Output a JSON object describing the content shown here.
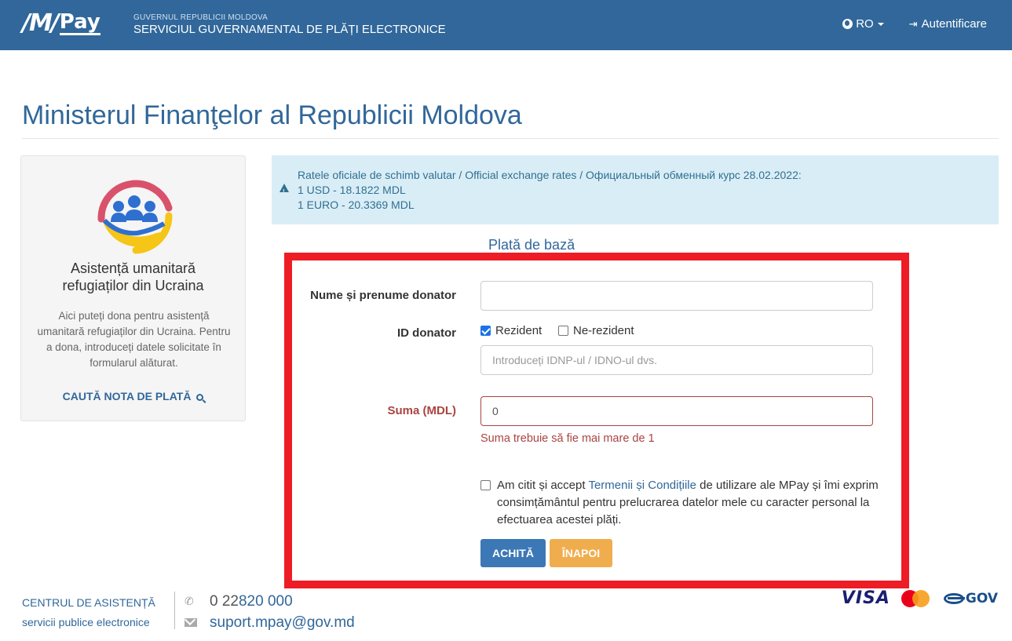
{
  "header": {
    "logo_mark": "/M/",
    "logo_pay": "Pay",
    "gov_subtitle": "GUVERNUL REPUBLICII MOLDOVA",
    "gov_title": "SERVICIUL GUVERNAMENTAL DE PLĂȚI ELECTRONICE",
    "language": "RO",
    "login": "Autentificare",
    "icons": {
      "language": "globe-icon",
      "login": "sign-in-icon"
    }
  },
  "page_title": "Ministerul Finanţelor al Republicii Moldova",
  "sidebar": {
    "title_line1": "Asistență umanitară",
    "title_line2": "refugiaților din Ucraina",
    "text": "Aici puteți dona pentru asistență umanitară refugiaților din Ucraina. Pentru a dona, introduceți datele solicitate în formularul alăturat.",
    "link": "CAUTĂ NOTA DE PLATĂ",
    "link_icon": "search-icon"
  },
  "alert": {
    "icon": "warning-icon",
    "line1": "Ratele oficiale de schimb valutar / Official exchange rates / Официальный обменный курс 28.02.2022:",
    "line2": "1 USD - 18.1822 MDL",
    "line3": "1 EURO - 20.3369 MDL"
  },
  "form": {
    "section_title": "Plată de bază",
    "donor_name_label": "Nume și prenume donator",
    "donor_name_value": "",
    "donor_id_label": "ID donator",
    "resident_label": "Rezident",
    "resident_checked": true,
    "nonresident_label": "Ne-rezident",
    "nonresident_checked": false,
    "id_placeholder": "Introduceți IDNP-ul / IDNO-ul dvs.",
    "amount_label": "Suma (MDL)",
    "amount_value": "0",
    "amount_error": "Suma trebuie să fie mai mare de 1",
    "terms_before": "Am citit și accept ",
    "terms_link": "Termenii și Condițiile",
    "terms_after": " de utilizare ale MPay și îmi exprim consimțământul pentru prelucrarea datelor mele cu caracter personal la efectuarea acestei plăți.",
    "terms_checked": false,
    "pay_button": "ACHITĂ",
    "back_button": "ÎNAPOI",
    "highlight_color": "#ee1c25"
  },
  "footer": {
    "support_line1": "CENTRUL DE ASISTENȚĂ",
    "support_line2": "servicii publice electronice",
    "phone_prefix": "0 22 ",
    "phone_number": "820 000",
    "email": "suport.mpay@gov.md",
    "icons": {
      "phone": "phone-icon",
      "email": "envelope-icon"
    },
    "payment_logos": {
      "visa": "VISA",
      "mastercard": "MasterCard",
      "egov": "GOV"
    }
  },
  "colors": {
    "brand": "#31679a",
    "alert_bg": "#d9edf7",
    "error": "#a94442",
    "primary_button": "#3c78b5",
    "warning_button": "#f0ad4e"
  }
}
